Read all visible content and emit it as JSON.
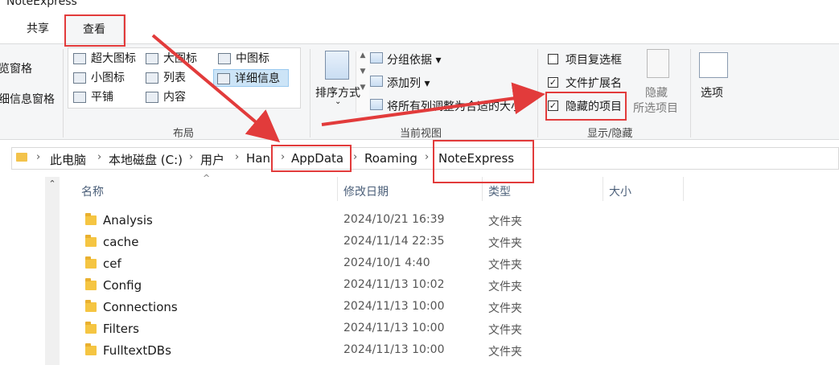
{
  "window": {
    "title": "NoteExpress"
  },
  "tabs": [
    {
      "label": "共享"
    },
    {
      "label": "查看"
    }
  ],
  "panes": {
    "preview": "览窗格",
    "details": "细信息窗格"
  },
  "layout": {
    "items": [
      {
        "label": "超大图标"
      },
      {
        "label": "大图标"
      },
      {
        "label": "中图标"
      },
      {
        "label": "小图标"
      },
      {
        "label": "列表"
      },
      {
        "label": "详细信息"
      },
      {
        "label": "平铺"
      },
      {
        "label": "内容"
      }
    ],
    "group_label": "布局"
  },
  "current_view": {
    "sort_label": "排序方式",
    "group_by": "分组依据",
    "add_column": "添加列",
    "fit_columns": "将所有列调整为合适的大小",
    "group_label": "当前视图"
  },
  "show_hide": {
    "item_checkboxes": "项目复选框",
    "file_extensions": "文件扩展名",
    "hidden_items": "隐藏的项目",
    "hide_selected_1": "隐藏",
    "hide_selected_2": "所选项目",
    "group_label": "显示/隐藏",
    "file_extensions_checked": true,
    "hidden_items_checked": true,
    "item_checkboxes_checked": false
  },
  "options_label": "选项",
  "breadcrumb": [
    {
      "label": "此电脑"
    },
    {
      "label": "本地磁盘 (C:)"
    },
    {
      "label": "用户"
    },
    {
      "label": "Han"
    },
    {
      "label": "AppData"
    },
    {
      "label": "Roaming"
    },
    {
      "label": "NoteExpress"
    }
  ],
  "columns": {
    "name": "名称",
    "modified": "修改日期",
    "type": "类型",
    "size": "大小"
  },
  "files": [
    {
      "name": "Analysis",
      "modified": "2024/10/21 16:39",
      "type": "文件夹"
    },
    {
      "name": "cache",
      "modified": "2024/11/14 22:35",
      "type": "文件夹"
    },
    {
      "name": "cef",
      "modified": "2024/10/1 4:40",
      "type": "文件夹"
    },
    {
      "name": "Config",
      "modified": "2024/11/13 10:02",
      "type": "文件夹"
    },
    {
      "name": "Connections",
      "modified": "2024/11/13 10:00",
      "type": "文件夹"
    },
    {
      "name": "Filters",
      "modified": "2024/11/13 10:00",
      "type": "文件夹"
    },
    {
      "name": "FulltextDBs",
      "modified": "2024/11/13 10:00",
      "type": "文件夹"
    }
  ],
  "colors": {
    "annotation": "#e23b3b",
    "selected": "#cce4f7",
    "folder": "#f5c542"
  }
}
